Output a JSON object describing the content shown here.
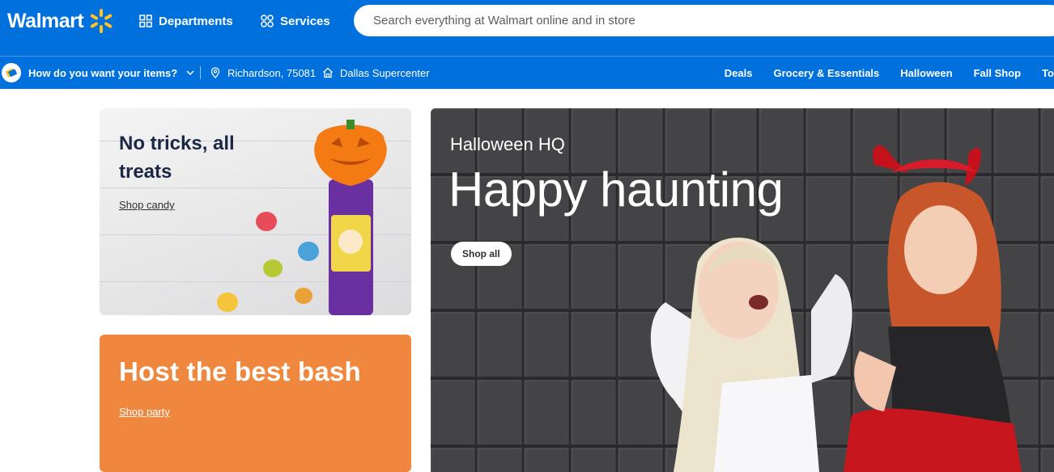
{
  "header": {
    "logo_text": "Walmart",
    "departments_label": "Departments",
    "services_label": "Services",
    "search_placeholder": "Search everything at Walmart online and in store"
  },
  "subbar": {
    "fulfillment_prompt": "How do you want your items?",
    "location": "Richardson, 75081",
    "store": "Dallas Supercenter",
    "links": [
      "Deals",
      "Grocery & Essentials",
      "Halloween",
      "Fall Shop",
      "To"
    ]
  },
  "cards": {
    "candy": {
      "title": "No tricks, all treats",
      "link": "Shop candy"
    },
    "party": {
      "title": "Host the best bash",
      "link": "Shop party"
    },
    "hero": {
      "eyebrow": "Halloween HQ",
      "title": "Happy haunting",
      "button": "Shop all"
    }
  },
  "colors": {
    "brand_blue": "#0071dc",
    "spark_yellow": "#ffc220",
    "party_orange": "#f0873e",
    "navy_text": "#1c2746"
  },
  "icons": {
    "logo": "spark-icon",
    "departments": "grid-icon",
    "services": "services-icon",
    "fulfillment": "delivery-icon",
    "location": "map-pin-icon",
    "store": "store-icon"
  }
}
